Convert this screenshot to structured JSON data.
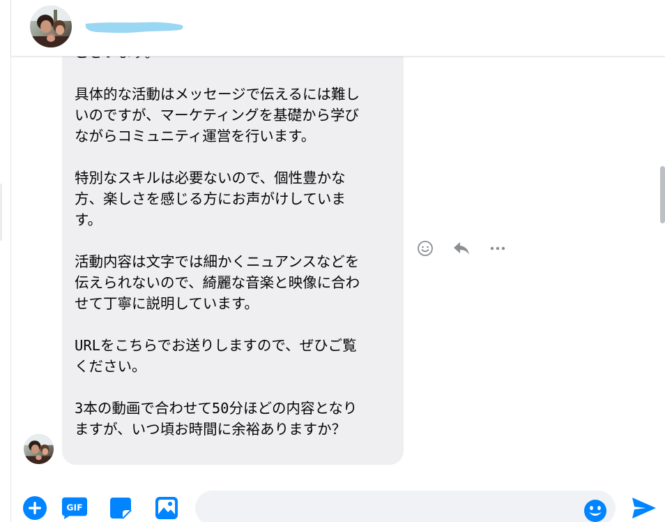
{
  "conversation": {
    "header": {
      "avatar": "contact-avatar-photo",
      "name_redaction_color": "#9ad7f3"
    },
    "message": {
      "lines": "ございます。\n\n具体的な活動はメッセージで伝えるには難し\nいのですが、マーケティングを基礎から学び\nながらコミュニティ運営を行います。\n\n特別なスキルは必要ないので、個性豊かな\n方、楽しさを感じる方にお声がけしていま\nす。\n\n活動内容は文字では細かくニュアンスなどを\n伝えられないので、綺麗な音楽と映像に合わ\nせて丁寧に説明しています。\n\nURLをこちらでお送りしますので、ぜひご覧\nください。\n\n3本の動画で合わせて50分ほどの内容となり\nますが、いつ頃お時間に余裕ありますか？",
      "bubble_color": "#efeef0",
      "sender_avatar": "sender-avatar-photo"
    },
    "message_actions": [
      "smile-icon",
      "reply-icon",
      "more-icon"
    ]
  },
  "composer": {
    "tools": [
      "plus-icon",
      "gif-icon",
      "sticker-icon",
      "image-icon"
    ],
    "gif_label": "GIF",
    "input_value": "",
    "input_placeholder": "",
    "emoji_icon": "emoji-icon",
    "send_icon": "send-icon",
    "accent_color": "#0084ff"
  }
}
